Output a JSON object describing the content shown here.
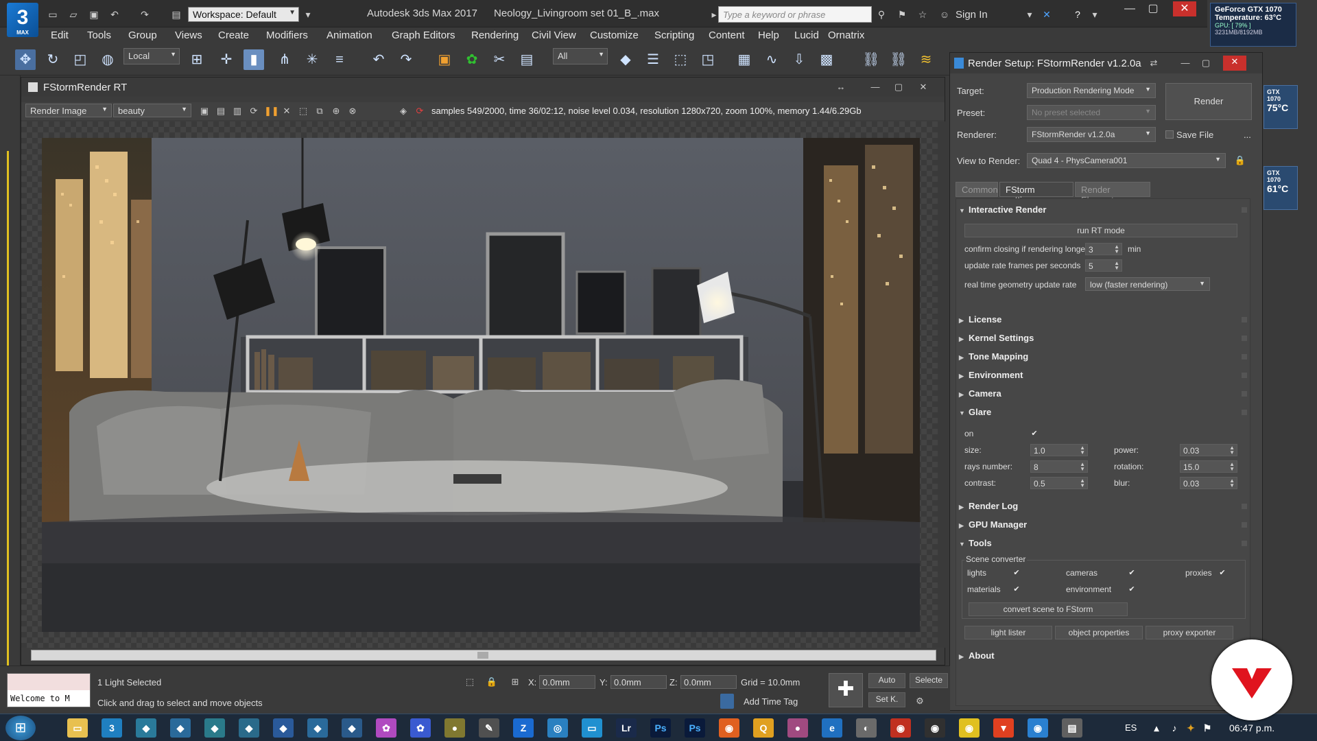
{
  "app": {
    "logo_text": "3",
    "logo_sub": "MAX",
    "workspace": "Workspace: Default",
    "title": "Autodesk 3ds Max 2017",
    "file": "Neology_Livingroom set 01_B_.max",
    "search_placeholder": "Type a keyword or phrase",
    "sign_in": "Sign In"
  },
  "menu": [
    "Edit",
    "Tools",
    "Group",
    "Views",
    "Create",
    "Modifiers",
    "Animation",
    "Graph Editors",
    "Rendering",
    "Civil View",
    "Customize",
    "Scripting",
    "Content",
    "Help",
    "Lucid",
    "Ornatrix"
  ],
  "toolbar": {
    "coord_system": "Local",
    "selection_filter": "All"
  },
  "frame_window": {
    "title": "FStormRender RT",
    "area_to_render": "Render Image",
    "channel": "beauty",
    "status": "samples 549/2000, time 36/02:12, noise level 0.034, resolution 1280x720, zoom 100%, memory 1.44/6.29Gb"
  },
  "render_setup": {
    "title": "Render Setup: FStormRender v1.2.0a",
    "target_label": "Target:",
    "target_value": "Production Rendering Mode",
    "preset_label": "Preset:",
    "preset_value": "No preset selected",
    "renderer_label": "Renderer:",
    "renderer_value": "FStormRender v1.2.0a",
    "save_file": "Save File",
    "view_label": "View to Render:",
    "view_value": "Quad 4 - PhysCamera001",
    "render_button": "Render",
    "more_button": "...",
    "tabs": [
      "Common",
      "FStorm settings",
      "Render Elements"
    ],
    "interactive": {
      "title": "Interactive Render",
      "run_rt": "run RT mode",
      "confirm_label": "confirm closing if rendering longer",
      "confirm_value": "3",
      "confirm_unit": "min",
      "update_label": "update rate frames per seconds",
      "update_value": "5",
      "geometry_label": "real time geometry update rate",
      "geometry_value": "low (faster rendering)"
    },
    "collapsed_rollouts": [
      "License",
      "Kernel Settings",
      "Tone Mapping",
      "Environment",
      "Camera"
    ],
    "glare": {
      "title": "Glare",
      "on_label": "on",
      "size_label": "size:",
      "size_value": "1.0",
      "power_label": "power:",
      "power_value": "0.03",
      "rays_label": "rays number:",
      "rays_value": "8",
      "rotation_label": "rotation:",
      "rotation_value": "15.0",
      "contrast_label": "contrast:",
      "contrast_value": "0.5",
      "blur_label": "blur:",
      "blur_value": "0.03"
    },
    "render_log": "Render Log",
    "gpu_manager": "GPU Manager",
    "tools": {
      "title": "Tools",
      "scene_converter": "Scene converter",
      "lights": "lights",
      "cameras": "cameras",
      "proxies": "proxies",
      "materials": "materials",
      "environment": "environment",
      "convert_button": "convert scene to FStorm",
      "light_lister": "light  lister",
      "object_properties": "object properties",
      "proxy_exporter": "proxy exporter"
    },
    "about": "About"
  },
  "gpu": {
    "name": "GeForce GTX 1070",
    "temperature": "Temperature: 63°C",
    "gpu_load": "GPU: [ 79% ]",
    "memory": "3231MB/8192MB",
    "side1_name": "GTX 1070",
    "side1_temp": "75°C",
    "side2_name": "GTX 1070",
    "side2_temp": "61°C"
  },
  "statusbar": {
    "maxscript_text": "Welcome to M",
    "selection": "1 Light Selected",
    "prompt": "Click and drag to select and move objects",
    "x_label": "X:",
    "x_value": "0.0mm",
    "y_label": "Y:",
    "y_value": "0.0mm",
    "z_label": "Z:",
    "z_value": "0.0mm",
    "grid": "Grid = 10.0mm",
    "auto_key": "Auto",
    "set_key": "Set K.",
    "selected": "Selecte",
    "add_time_tag": "Add Time Tag"
  },
  "taskbar": {
    "language": "ES",
    "clock": "06:47 p.m."
  },
  "colors": {
    "brand_red": "#e0141e"
  }
}
